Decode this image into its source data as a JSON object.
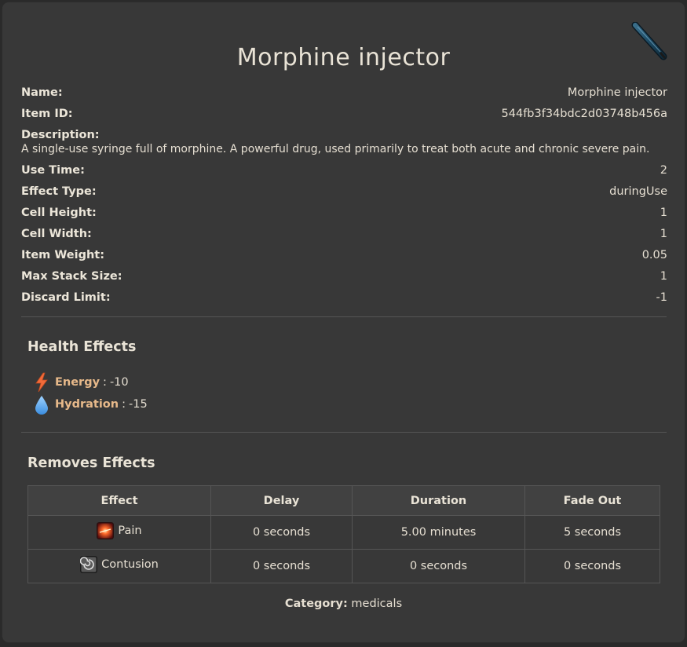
{
  "item": {
    "title": "Morphine injector",
    "icon": "syringe-icon"
  },
  "properties": {
    "name": {
      "label": "Name:",
      "value": "Morphine injector"
    },
    "item_id": {
      "label": "Item ID:",
      "value": "544fb3f34bdc2d03748b456a"
    },
    "description": {
      "label": "Description:",
      "value": "A single-use syringe full of morphine. A powerful drug, used primarily to treat both acute and chronic severe pain."
    },
    "use_time": {
      "label": "Use Time:",
      "value": "2"
    },
    "effect_type": {
      "label": "Effect Type:",
      "value": "duringUse"
    },
    "cell_height": {
      "label": "Cell Height:",
      "value": "1"
    },
    "cell_width": {
      "label": "Cell Width:",
      "value": "1"
    },
    "item_weight": {
      "label": "Item Weight:",
      "value": "0.05"
    },
    "max_stack": {
      "label": "Max Stack Size:",
      "value": "1"
    },
    "discard_limit": {
      "label": "Discard Limit:",
      "value": "-1"
    }
  },
  "health_effects": {
    "title": "Health Effects",
    "items": [
      {
        "name": "Energy",
        "value": "-10",
        "icon": "lightning-icon",
        "color": "#f26b3a"
      },
      {
        "name": "Hydration",
        "value": "-15",
        "icon": "water-drop-icon",
        "color": "#5aa9f0"
      }
    ]
  },
  "removes_effects": {
    "title": "Removes Effects",
    "headers": [
      "Effect",
      "Delay",
      "Duration",
      "Fade Out"
    ],
    "rows": [
      {
        "effect": "Pain",
        "icon": "pain-icon",
        "delay": "0 seconds",
        "duration": "5.00 minutes",
        "fade_out": "5 seconds"
      },
      {
        "effect": "Contusion",
        "icon": "contusion-icon",
        "delay": "0 seconds",
        "duration": "0 seconds",
        "fade_out": "0 seconds"
      }
    ]
  },
  "category": {
    "label": "Category:",
    "value": "medicals"
  },
  "colors": {
    "background": "#383838",
    "text": "#e6dfd2",
    "effect_name": "#e7b98a",
    "divider": "#555555"
  }
}
